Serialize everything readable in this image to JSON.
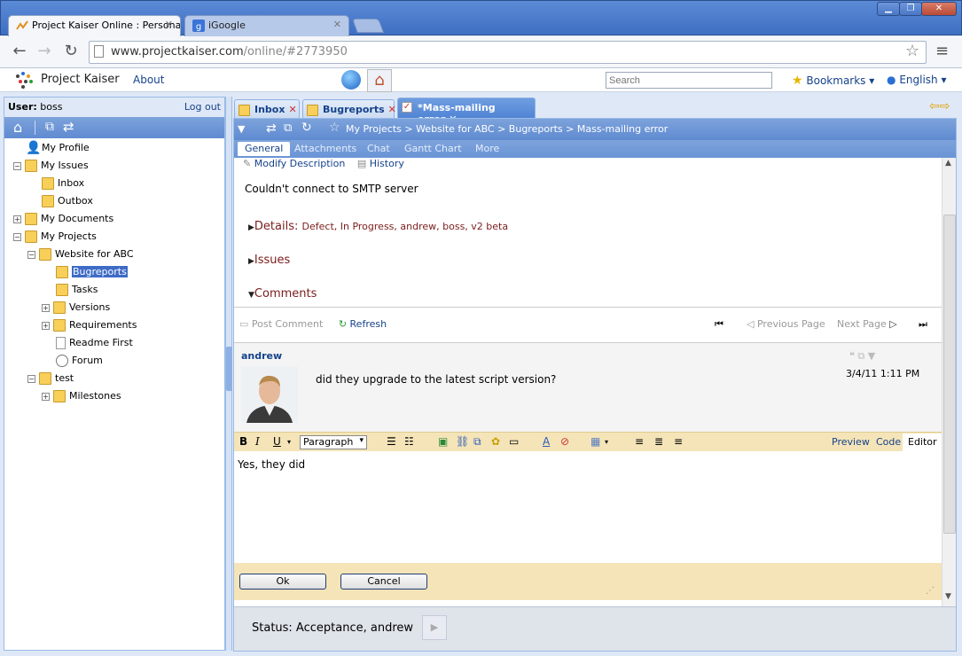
{
  "browser": {
    "tabs": [
      {
        "label": "Project Kaiser Online : Personal"
      },
      {
        "label": "iGoogle"
      }
    ],
    "url": {
      "host": "www.projectkaiser.com",
      "path": "/online/#2773950"
    },
    "window_controls": [
      "▁",
      "❐",
      "✕"
    ]
  },
  "header": {
    "logo": "Project Kaiser",
    "about": "About",
    "search_placeholder": "Search",
    "bookmarks": "Bookmarks",
    "language": "English"
  },
  "left": {
    "user_label": "User:",
    "user_name": "boss",
    "logout": "Log out",
    "tree": [
      {
        "label": "My Profile"
      },
      {
        "label": "My Issues"
      },
      {
        "label": "Inbox"
      },
      {
        "label": "Outbox"
      },
      {
        "label": "My Documents"
      },
      {
        "label": "My Projects"
      },
      {
        "label": "Website for ABC"
      },
      {
        "label": "Bugreports"
      },
      {
        "label": "Tasks"
      },
      {
        "label": "Versions"
      },
      {
        "label": "Requirements"
      },
      {
        "label": "Readme First"
      },
      {
        "label": "Forum"
      },
      {
        "label": "test"
      },
      {
        "label": "Milestones"
      }
    ]
  },
  "doc_tabs": [
    {
      "label": "Inbox"
    },
    {
      "label": "Bugreports"
    },
    {
      "label": "*Mass-mailing error"
    }
  ],
  "content": {
    "breadcrumb": "My Projects > Website for ABC > Bugreports > Mass-mailing error",
    "subtabs": [
      "General",
      "Attachments",
      "Chat",
      "Gantt Chart",
      "More"
    ],
    "modify_description": "Modify Description",
    "history": "History",
    "description": "Couldn't connect to SMTP server",
    "details_label": "Details:",
    "details_values": "Defect, In Progress, andrew, boss, v2 beta",
    "issues_label": "Issues",
    "comments_label": "Comments",
    "post_comment": "Post Comment",
    "refresh": "Refresh",
    "previous_page": "Previous Page",
    "next_page": "Next Page",
    "comment": {
      "author": "andrew",
      "text": "did they upgrade to the latest script version?",
      "date": "3/4/11 1:11 PM"
    },
    "editor": {
      "paragraph_select": "Paragraph",
      "mode_preview": "Preview",
      "mode_code": "Code",
      "mode_editor": "Editor",
      "text": "Yes, they did",
      "ok": "Ok",
      "cancel": "Cancel"
    },
    "status": "Status: Acceptance, andrew"
  },
  "colors": {
    "accent": "#5f8bd1",
    "link": "#15428b",
    "section": "#7a1c1c",
    "editor_bar": "#f4e4b8"
  }
}
